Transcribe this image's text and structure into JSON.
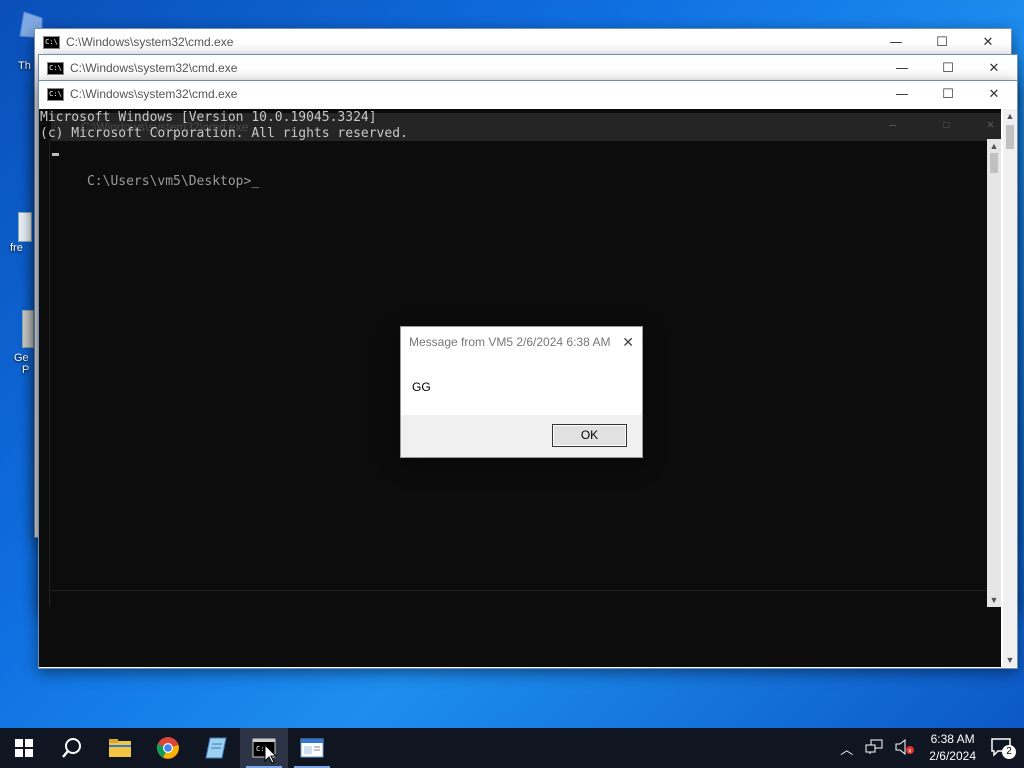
{
  "desktop": {
    "icons": [
      {
        "label": "Th"
      },
      {
        "label": "fre"
      },
      {
        "label": "Ge"
      },
      {
        "label": "P"
      }
    ]
  },
  "windows": {
    "back1_title": "C:\\Windows\\system32\\cmd.exe",
    "back2_title": "C:\\Windows\\system32\\cmd.exe",
    "front_title": "C:\\Windows\\system32\\cmd.exe",
    "ghost_title": "C:\\Windows\\system32\\cmd.exe",
    "icon_glyph": "C:\\",
    "min_glyph": "—",
    "max_glyph": "☐",
    "close_glyph": "✕"
  },
  "console": {
    "line1": "Microsoft Windows [Version 10.0.19045.3324]",
    "line2": "(c) Microsoft Corporation. All rights reserved.",
    "line3": "",
    "prompt": "C:\\Users\\vm5\\Desktop>",
    "cursor": "_"
  },
  "dialog": {
    "title": "Message from VM5 2/6/2024 6:38 AM",
    "message": "GG",
    "ok_label": "OK",
    "close_glyph": "✕"
  },
  "taskbar": {
    "start_icon": "windows-start",
    "search_icon": "search",
    "apps": [
      "file-explorer",
      "chrome",
      "notepad",
      "cmd",
      "remote-app"
    ]
  },
  "tray": {
    "chevron": "^",
    "time": "6:38 AM",
    "date": "2/6/2024",
    "notification_count": "2"
  },
  "colors": {
    "console_bg": "#0c0c0c",
    "console_text": "#bdbdbd",
    "taskbar_bg": "#101522",
    "desktop_blue": "#0f6fe0"
  }
}
